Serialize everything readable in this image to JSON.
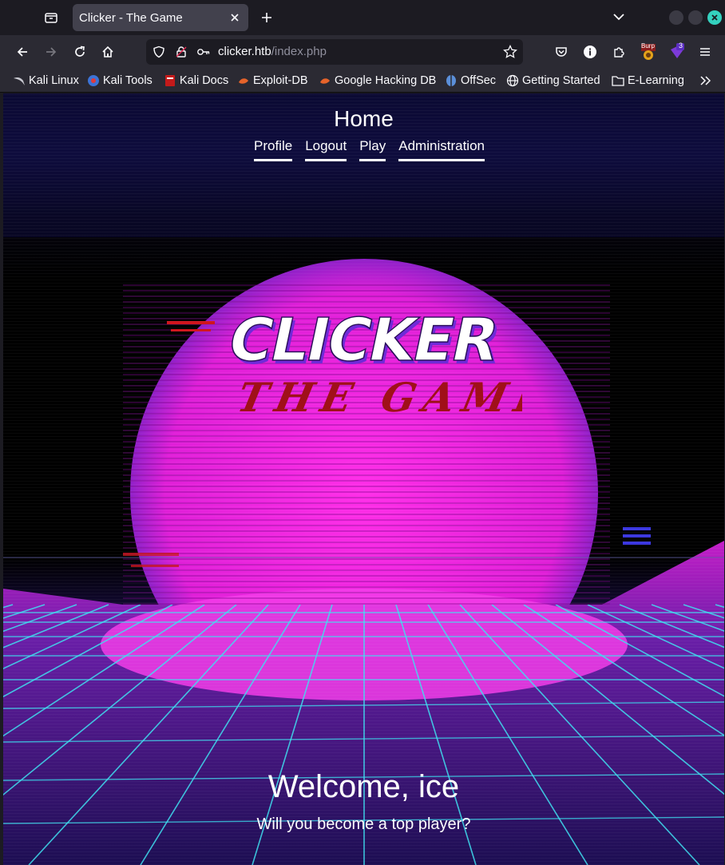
{
  "browser": {
    "tab_title": "Clicker - The Game",
    "url_host": "clicker.htb",
    "url_path": "/index.php",
    "bookmarks": [
      {
        "label": "Kali Linux",
        "icon": "kali-dragon-icon"
      },
      {
        "label": "Kali Tools",
        "icon": "kali-tools-icon"
      },
      {
        "label": "Kali Docs",
        "icon": "kali-docs-icon"
      },
      {
        "label": "Exploit-DB",
        "icon": "exploit-db-icon"
      },
      {
        "label": "Google Hacking DB",
        "icon": "ghdb-icon"
      },
      {
        "label": "OffSec",
        "icon": "offsec-icon"
      },
      {
        "label": "Getting Started",
        "icon": "globe-icon"
      },
      {
        "label": "E-Learning",
        "icon": "folder-icon"
      }
    ],
    "extension_badge": "3",
    "burp_label": "Burp"
  },
  "page": {
    "title": "Home",
    "nav": [
      "Profile",
      "Logout",
      "Play",
      "Administration"
    ],
    "logo_main": "CLICKER",
    "logo_sub": "THE GAME",
    "welcome": "Welcome, ice",
    "tagline": "Will you become a top player?"
  },
  "colors": {
    "sun": "#e41bd8",
    "grid": "#3ee0f0",
    "ground": "#2a1470",
    "logo_red": "#b3121c"
  }
}
